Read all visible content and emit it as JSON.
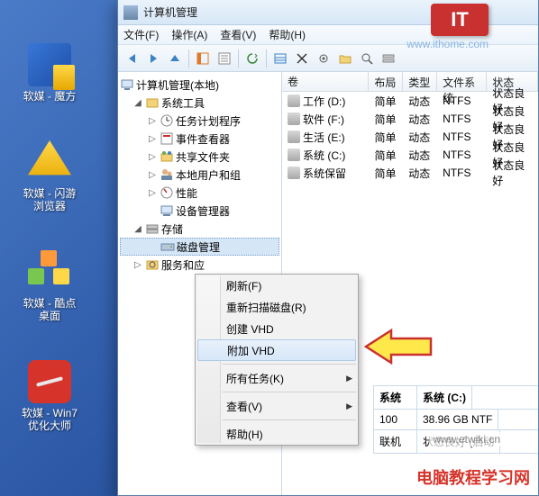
{
  "desktop": {
    "icons": [
      {
        "label": "软媒 - 魔方"
      },
      {
        "label": "软媒 - 闪游浏览器"
      },
      {
        "label": "软媒 - 酷点桌面"
      },
      {
        "label": "软媒 - Win7优化大师"
      }
    ]
  },
  "logo": {
    "text": "IT"
  },
  "url_wm": "www.ithome.com",
  "window": {
    "title": "计算机管理",
    "menus": [
      "文件(F)",
      "操作(A)",
      "查看(V)",
      "帮助(H)"
    ]
  },
  "tree": {
    "root": "计算机管理(本地)",
    "systools": "系统工具",
    "systools_children": [
      "任务计划程序",
      "事件查看器",
      "共享文件夹",
      "本地用户和组",
      "性能",
      "设备管理器"
    ],
    "storage": "存储",
    "diskmgmt": "磁盘管理",
    "services": "服务和应"
  },
  "list": {
    "headers": [
      "卷",
      "布局",
      "类型",
      "文件系统",
      "状态"
    ],
    "rows": [
      {
        "vol": "工作 (D:)",
        "lay": "简单",
        "typ": "动态",
        "fs": "NTFS",
        "st": "状态良好"
      },
      {
        "vol": "软件 (F:)",
        "lay": "简单",
        "typ": "动态",
        "fs": "NTFS",
        "st": "状态良好"
      },
      {
        "vol": "生活 (E:)",
        "lay": "简单",
        "typ": "动态",
        "fs": "NTFS",
        "st": "状态良好"
      },
      {
        "vol": "系统 (C:)",
        "lay": "简单",
        "typ": "动态",
        "fs": "NTFS",
        "st": "状态良好"
      },
      {
        "vol": "系统保留",
        "lay": "简单",
        "typ": "动态",
        "fs": "NTFS",
        "st": "状态良好"
      }
    ]
  },
  "lowpanel": {
    "l1a": "系统",
    "l1b": "系统 (C:)",
    "l2a": "100",
    "l2b": "38.96 GB NTF",
    "l3a": "联机",
    "l3b": "状态良好 (启动"
  },
  "ctx": {
    "items": [
      {
        "label": "刷新(F)"
      },
      {
        "label": "重新扫描磁盘(R)"
      },
      {
        "label": "创建 VHD"
      },
      {
        "label": "附加 VHD",
        "hl": true
      },
      {
        "sep": true
      },
      {
        "label": "所有任务(K)",
        "sub": true
      },
      {
        "sep": true
      },
      {
        "label": "查看(V)",
        "sub": true
      },
      {
        "sep": true
      },
      {
        "label": "帮助(H)"
      }
    ]
  },
  "wm1": "www.etwiki.cn",
  "wm2": "电脑教程学习网"
}
